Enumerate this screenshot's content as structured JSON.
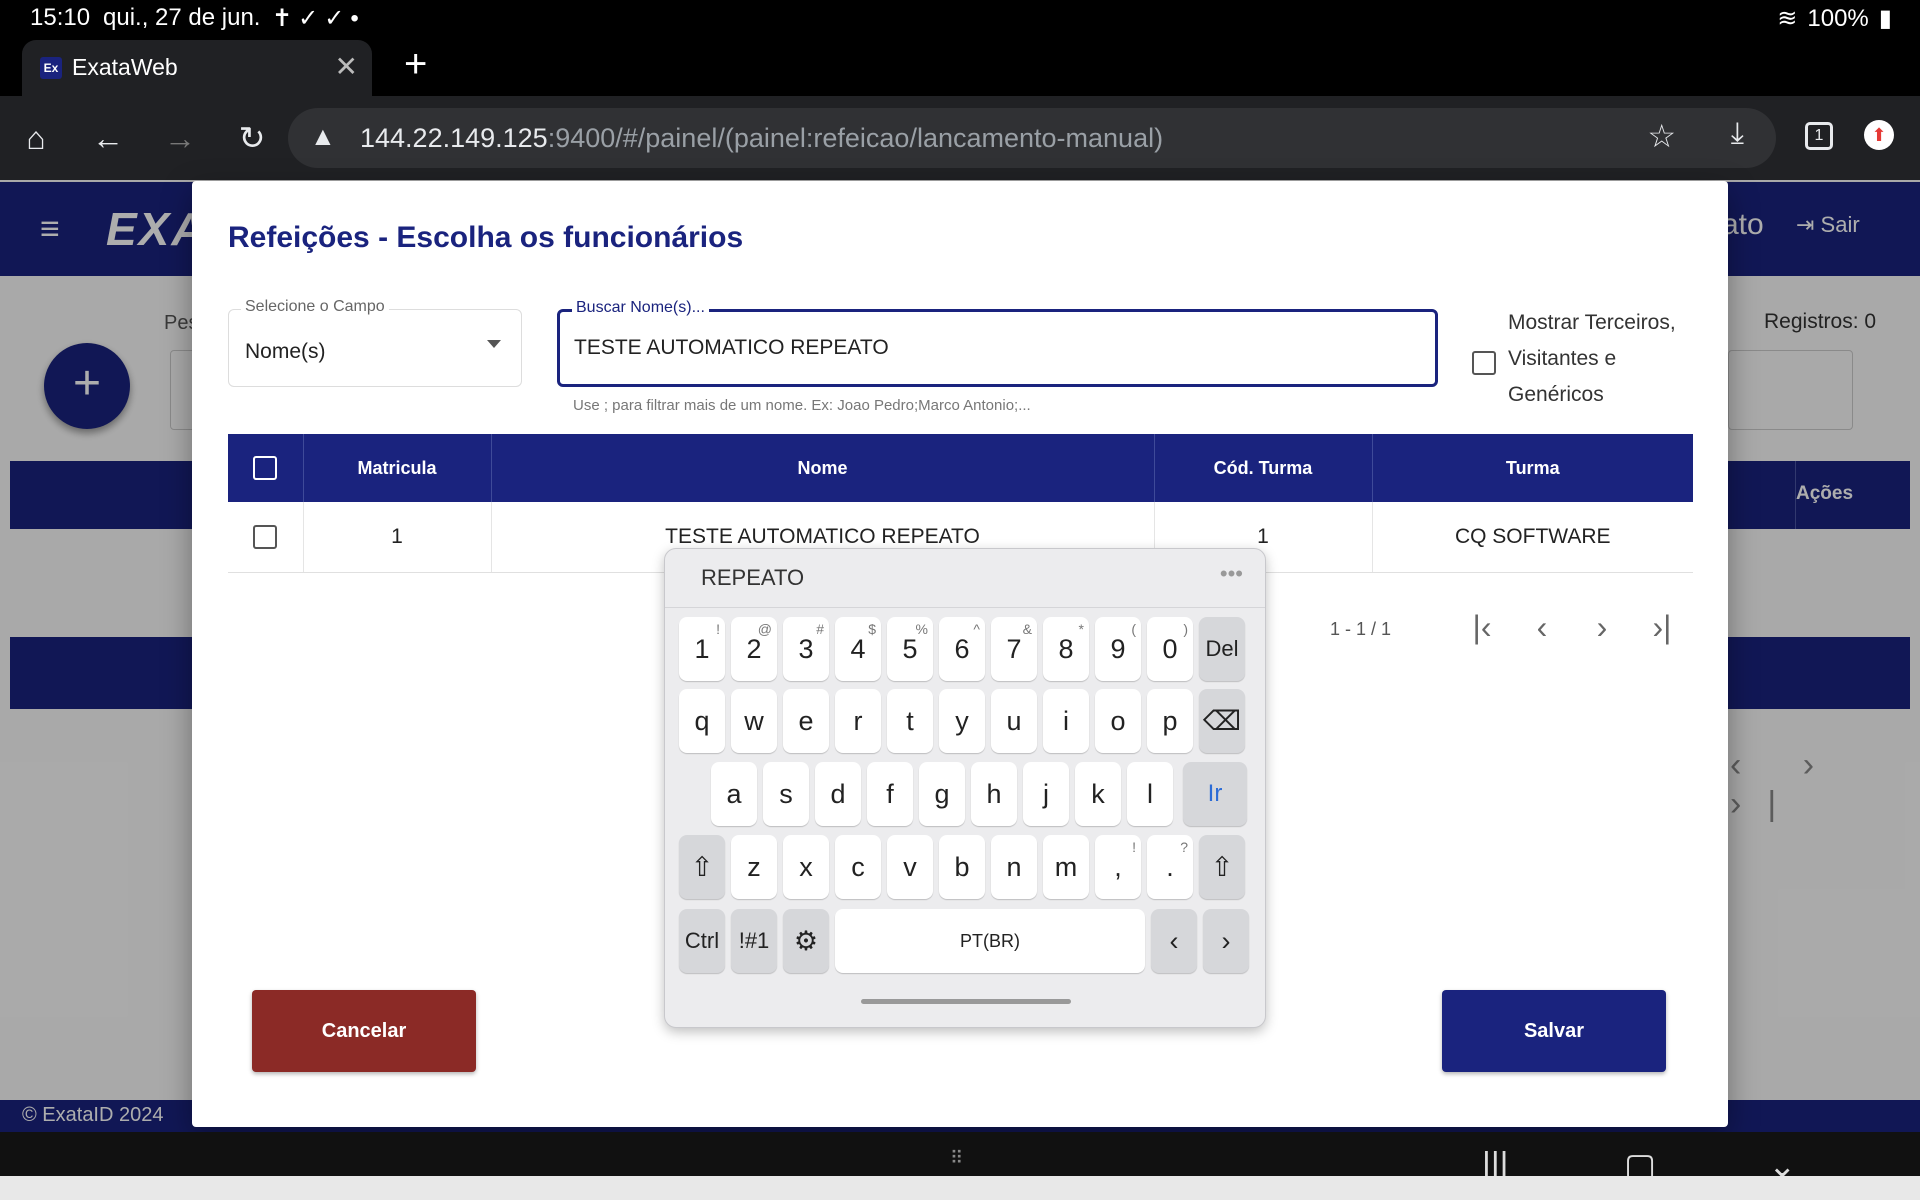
{
  "status": {
    "time": "15:10",
    "date": "qui., 27 de jun.",
    "battery": "100%"
  },
  "browser": {
    "tab_title": "ExataWeb",
    "favicon": "Ex",
    "url_host": "144.22.149.125",
    "url_rest": ":9400/#/painel/(painel:refeicao/lancamento-manual)",
    "tab_count": "1"
  },
  "page_bg": {
    "logo": "EXA",
    "user_fragment": "ato",
    "sair_label": "Sair",
    "pes_label": "Pes",
    "registros": "Registros: 0",
    "acoes_header": "Ações",
    "footer": "© ExataID 2024"
  },
  "dialog": {
    "title": "Refeições - Escolha os funcionários",
    "select_field": {
      "label": "Selecione o Campo",
      "value": "Nome(s)"
    },
    "search": {
      "label": "Buscar Nome(s)...",
      "value": "TESTE AUTOMATICO REPEATO",
      "hint": "Use ; para filtrar mais de um nome. Ex: Joao Pedro;Marco Antonio;..."
    },
    "mostrar_label": "Mostrar Terceiros, Visitantes e Genéricos",
    "table": {
      "headers": [
        "Matricula",
        "Nome",
        "Cód. Turma",
        "Turma"
      ],
      "rows": [
        {
          "matricula": "1",
          "nome": "TESTE AUTOMATICO REPEATO",
          "cod_turma": "1",
          "turma": "CQ SOFTWARE"
        }
      ]
    },
    "pager_info": "1 - 1 / 1",
    "cancel_label": "Cancelar",
    "save_label": "Salvar"
  },
  "keyboard": {
    "suggestion": "REPEATO",
    "number_row": [
      "1",
      "2",
      "3",
      "4",
      "5",
      "6",
      "7",
      "8",
      "9",
      "0"
    ],
    "number_sup": [
      "!",
      "@",
      "#",
      "$",
      "%",
      "^",
      "&",
      "*",
      "(",
      ")"
    ],
    "row1": [
      "q",
      "w",
      "e",
      "r",
      "t",
      "y",
      "u",
      "i",
      "o",
      "p"
    ],
    "row2": [
      "a",
      "s",
      "d",
      "f",
      "g",
      "h",
      "j",
      "k",
      "l"
    ],
    "row3": [
      "z",
      "x",
      "c",
      "v",
      "b",
      "n",
      "m"
    ],
    "del_label": "Del",
    "go_label": "Ir",
    "ctrl_label": "Ctrl",
    "sym_label": "!#1",
    "space_label": "PT(BR)"
  }
}
